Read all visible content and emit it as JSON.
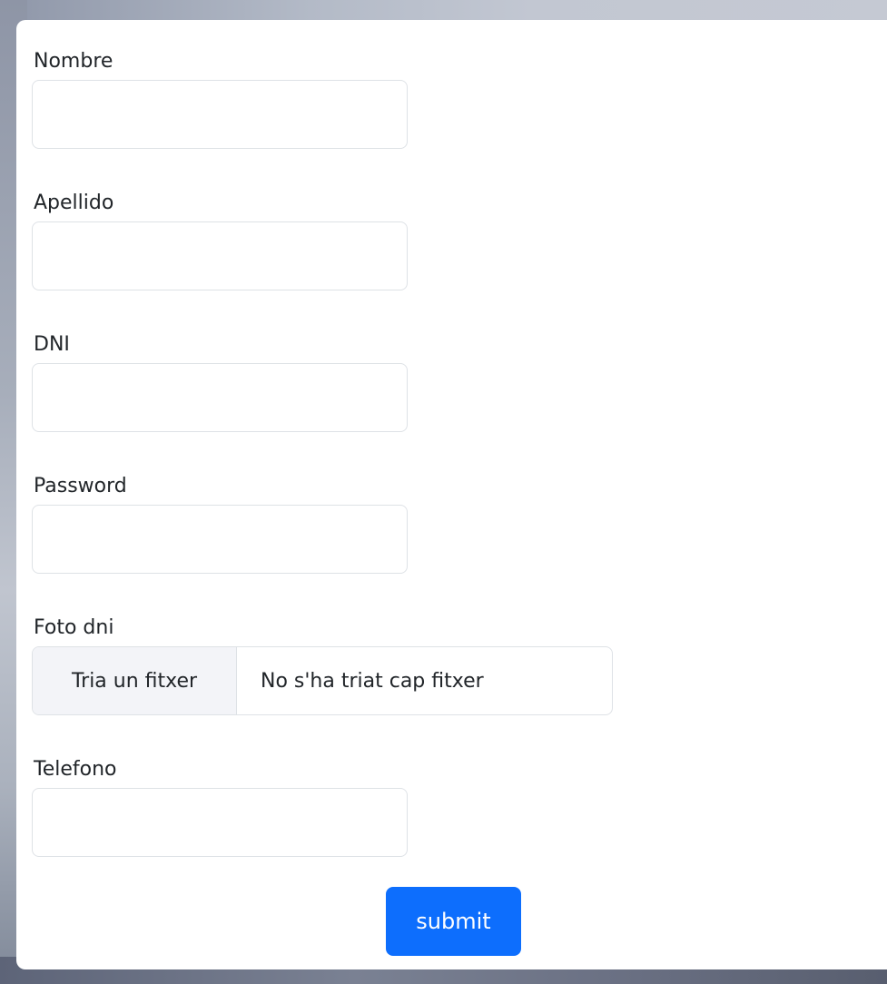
{
  "form": {
    "fields": {
      "nombre": {
        "label": "Nombre",
        "value": ""
      },
      "apellido": {
        "label": "Apellido",
        "value": ""
      },
      "dni": {
        "label": "DNI",
        "value": ""
      },
      "password": {
        "label": "Password",
        "value": ""
      },
      "foto_dni": {
        "label": "Foto dni",
        "button_label": "Tria un fitxer",
        "status": "No s'ha triat cap fitxer"
      },
      "telefono": {
        "label": "Telefono",
        "value": ""
      }
    },
    "submit_label": "submit"
  },
  "colors": {
    "primary": "#0d6efd",
    "border": "#dee2e6",
    "file_button_bg": "#f3f4f8",
    "text": "#212529"
  }
}
